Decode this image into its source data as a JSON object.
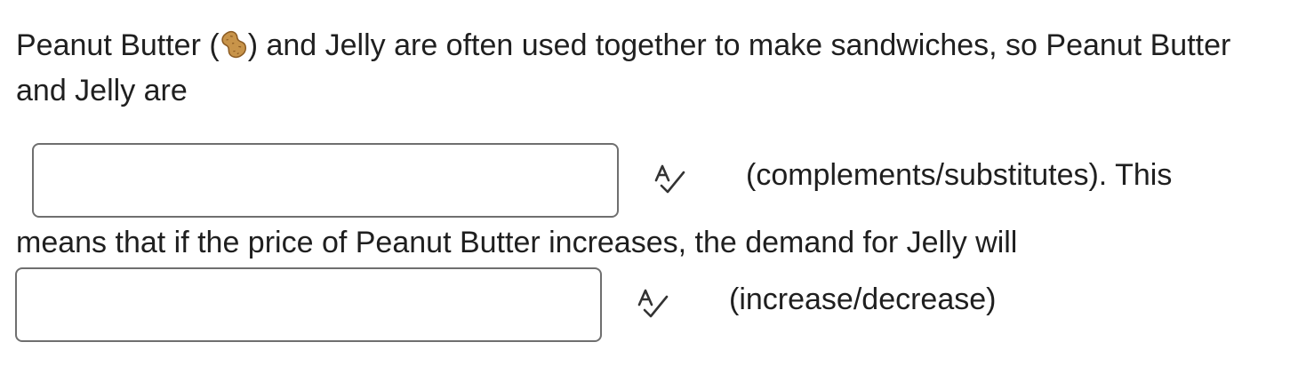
{
  "question": {
    "text_before_icon": "Peanut Butter (",
    "icon": "peanut-icon",
    "text_after_icon": ") and Jelly are often used together to make sandwiches, so Peanut Butter and Jelly are"
  },
  "blank1": {
    "value": "",
    "placeholder": "",
    "check_icon": "spell-check-icon",
    "hint": "(complements/substitutes). This"
  },
  "middle_text": "means that if the price of Peanut Butter increases, the demand for Jelly will",
  "blank2": {
    "value": "",
    "placeholder": "",
    "check_icon": "spell-check-icon",
    "hint": "(increase/decrease)"
  },
  "colors": {
    "text": "#1f1f1f",
    "border": "#6f6f6f",
    "peanut": "#c8944a"
  }
}
